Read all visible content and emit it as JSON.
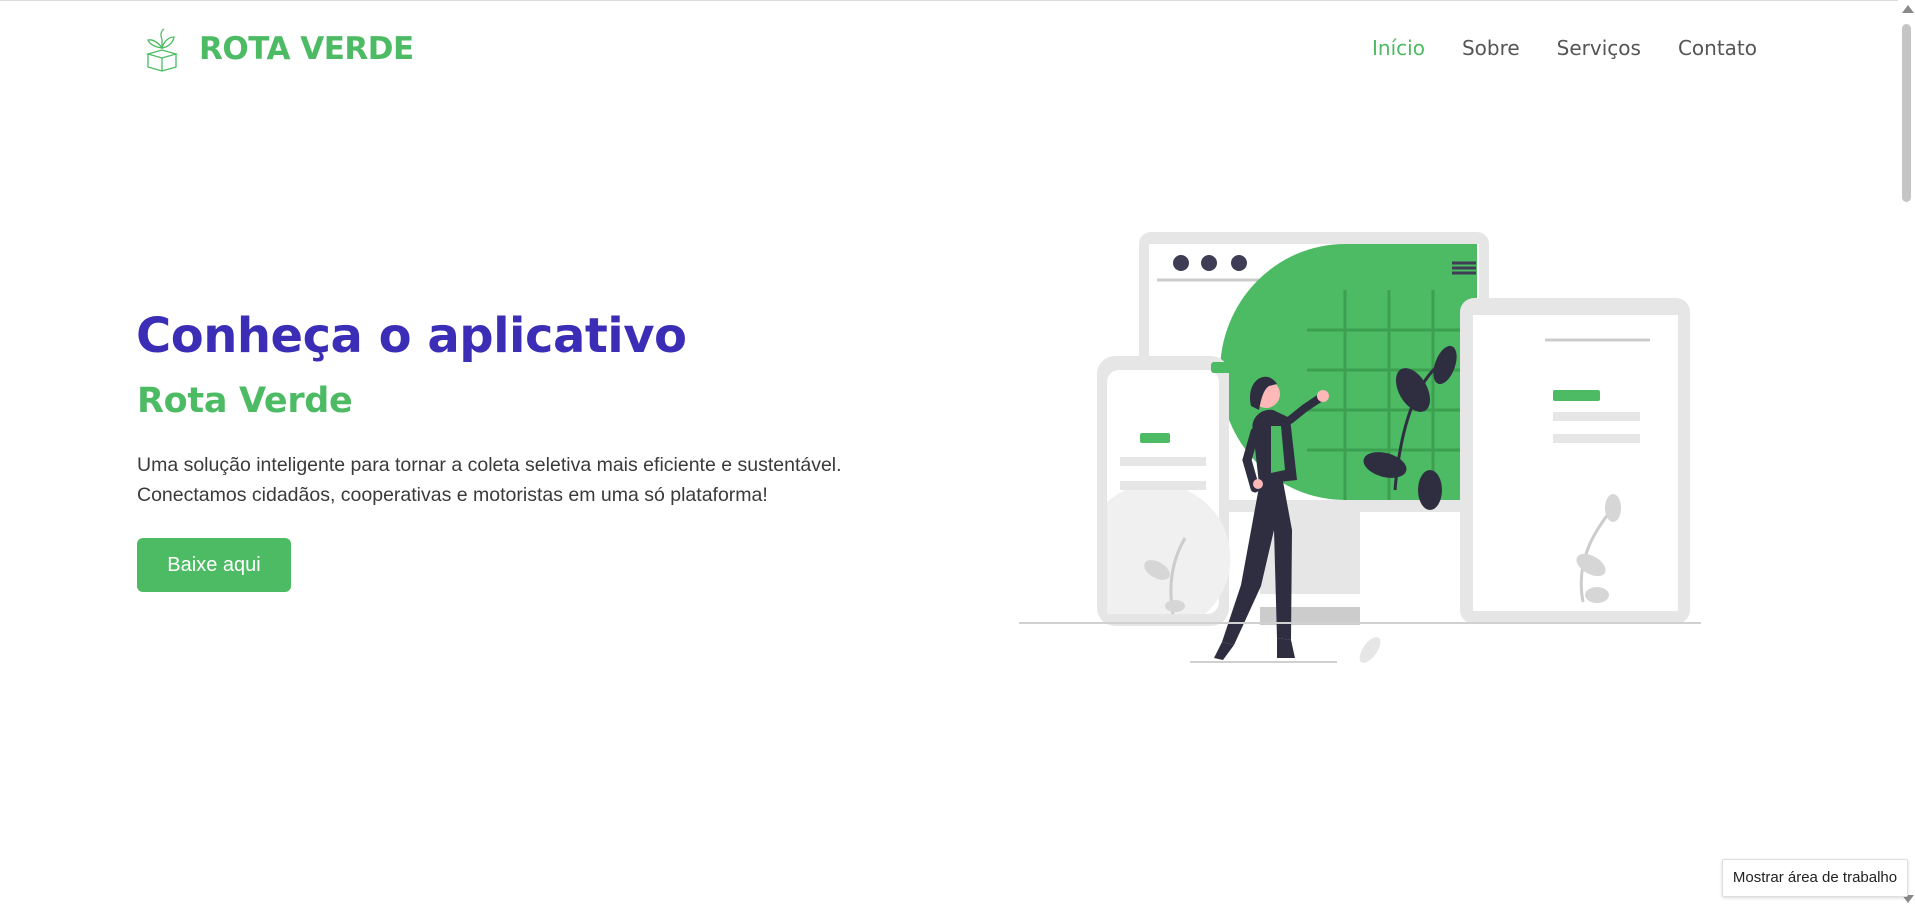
{
  "header": {
    "brand": "ROTA VERDE",
    "logo_icon": "recycling-box-plant-icon",
    "nav": [
      {
        "label": "Início",
        "active": true
      },
      {
        "label": "Sobre",
        "active": false
      },
      {
        "label": "Serviços",
        "active": false
      },
      {
        "label": "Contato",
        "active": false
      }
    ]
  },
  "hero": {
    "title": "Conheça o aplicativo",
    "subtitle": "Rota Verde",
    "description_line1": "Uma solução inteligente para tornar a coleta seletiva mais eficiente e sustentável.",
    "description_line2": "Conectamos cidadãos, cooperativas e motoristas em uma só plataforma!",
    "cta_label": "Baixe aqui",
    "illustration": "woman-with-devices-illustration"
  },
  "system": {
    "tooltip": "Mostrar área de trabalho"
  },
  "colors": {
    "brand_green": "#4cbb63",
    "title_purple": "#3b2db5",
    "text_dark": "#3a3a3a"
  }
}
